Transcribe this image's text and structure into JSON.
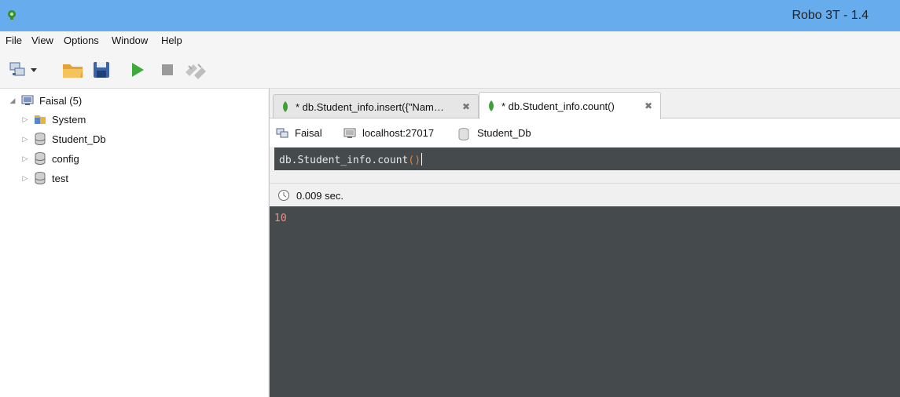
{
  "window": {
    "title": "Robo 3T - 1.4"
  },
  "menu": [
    "File",
    "View",
    "Options",
    "Window",
    "Help"
  ],
  "toolbar": {
    "icons": [
      "connect-icon",
      "dropdown-arrow-icon",
      "open-folder-icon",
      "save-icon",
      "execute-icon",
      "stop-icon",
      "format-icon"
    ]
  },
  "explorer": {
    "server": "Faisal (5)",
    "items": [
      {
        "label": "System",
        "icon": "folder-icon"
      },
      {
        "label": "Student_Db",
        "icon": "database-icon"
      },
      {
        "label": "config",
        "icon": "database-icon"
      },
      {
        "label": "test",
        "icon": "database-icon"
      }
    ]
  },
  "tabs": [
    {
      "label": "* db.Student_info.insert({\"Nam…",
      "active": false
    },
    {
      "label": "* db.Student_info.count()",
      "active": true
    }
  ],
  "info": {
    "connection": "Faisal",
    "host": "localhost:27017",
    "database": "Student_Db"
  },
  "editor": {
    "prefix": "db.Student_info.count",
    "parens": "()"
  },
  "status": {
    "time": "0.009 sec."
  },
  "result": {
    "value": "10"
  },
  "colors": {
    "titlebar": "#67aded",
    "editor_bg": "#454a4c",
    "mongo_green": "#3fa037",
    "paren_orange": "#e3833b",
    "result_number": "#e8938a"
  }
}
